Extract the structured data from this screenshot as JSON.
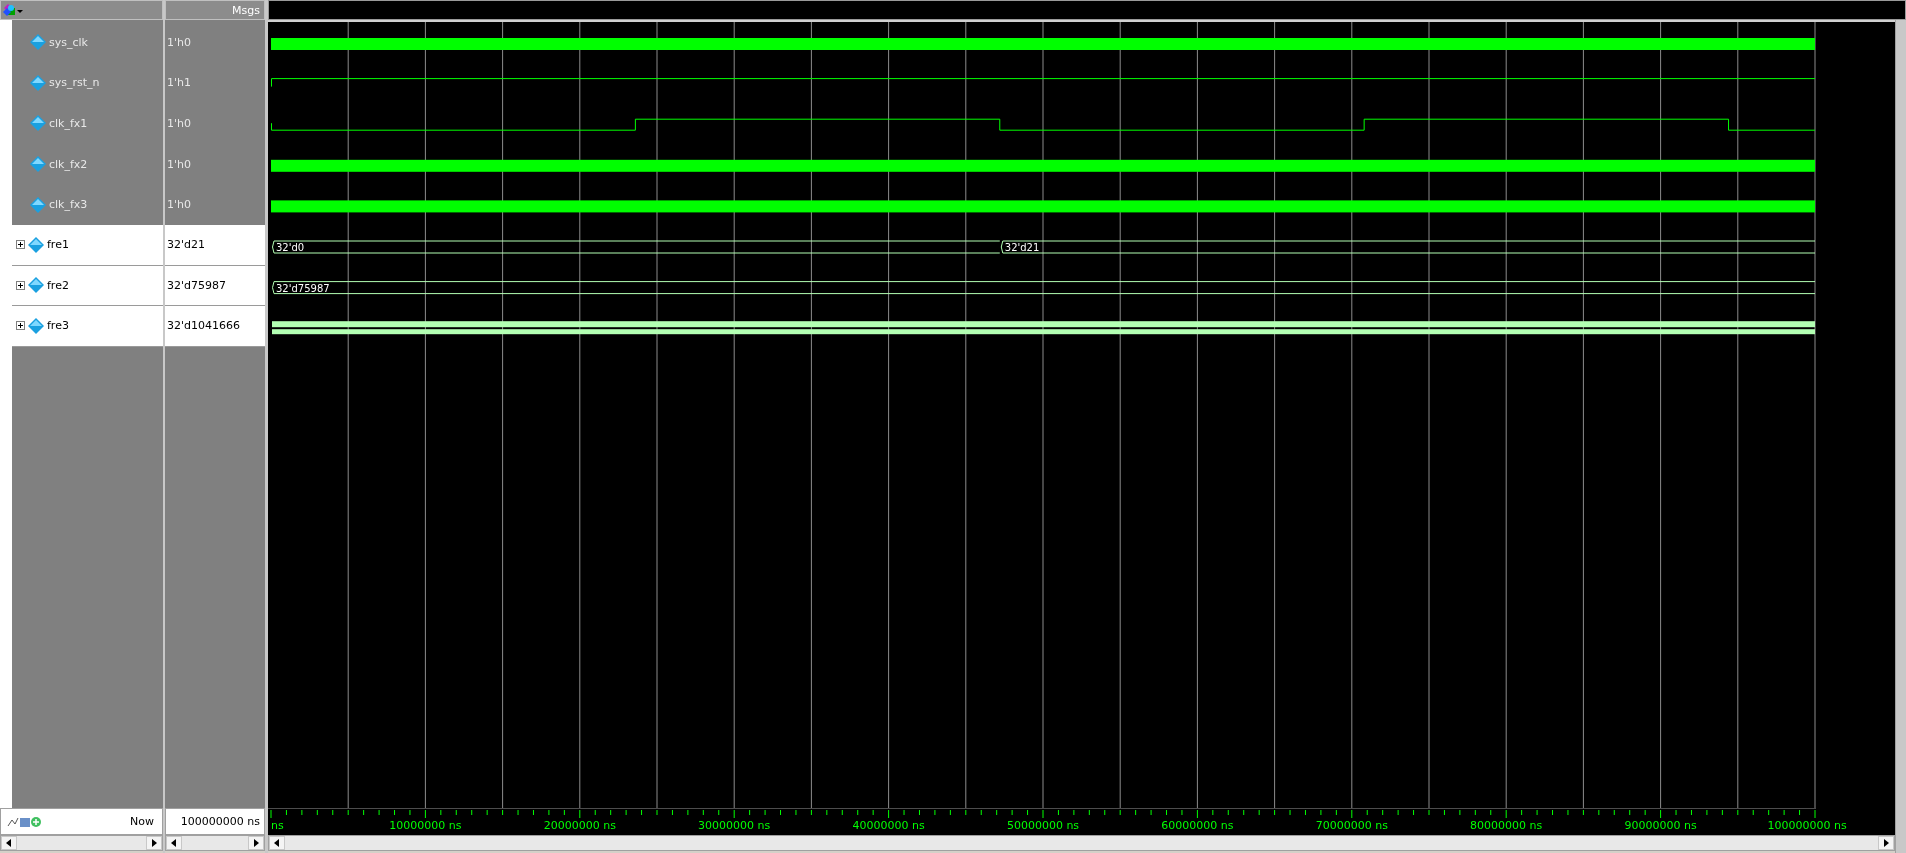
{
  "header": {
    "column_header": "Msgs"
  },
  "signals": [
    {
      "name": "sys_clk",
      "value": "1'h0",
      "kind": "clock",
      "selected": true
    },
    {
      "name": "sys_rst_n",
      "value": "1'h1",
      "kind": "high",
      "selected": true
    },
    {
      "name": "clk_fx1",
      "value": "1'h0",
      "kind": "slow-clock",
      "selected": true
    },
    {
      "name": "clk_fx2",
      "value": "1'h0",
      "kind": "clock",
      "selected": true
    },
    {
      "name": "clk_fx3",
      "value": "1'h0",
      "kind": "clock",
      "selected": true
    },
    {
      "name": "fre1",
      "value": "32'd21",
      "kind": "bus",
      "selected": false,
      "expanded": false,
      "segments": [
        "32'd0",
        "32'd21"
      ]
    },
    {
      "name": "fre2",
      "value": "32'd75987",
      "kind": "bus",
      "selected": false,
      "expanded": false,
      "segments": [
        "32'd75987"
      ]
    },
    {
      "name": "fre3",
      "value": "32'd1041666",
      "kind": "dense-bus",
      "selected": false,
      "expanded": false
    }
  ],
  "cursor": {
    "label": "Now",
    "time": "100000000 ns"
  },
  "time_axis": {
    "ticks": [
      "ns",
      "10000000 ns",
      "20000000 ns",
      "30000000 ns",
      "40000000 ns",
      "50000000 ns",
      "60000000 ns",
      "70000000 ns",
      "80000000 ns",
      "90000000 ns",
      "100000000 ns"
    ]
  }
}
